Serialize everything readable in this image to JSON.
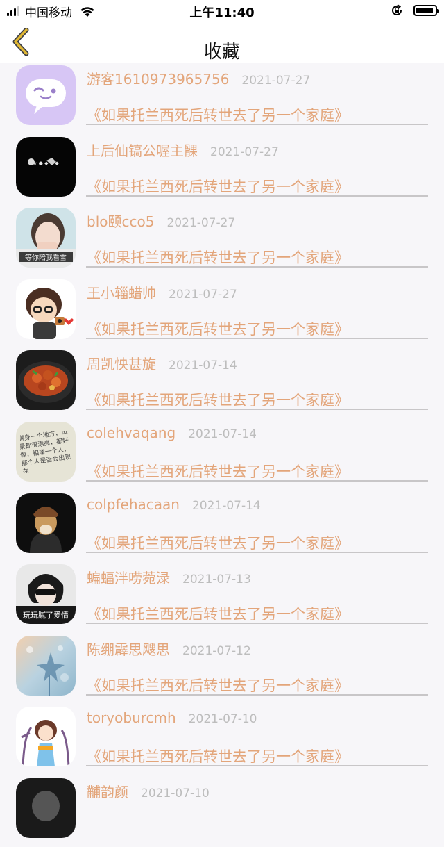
{
  "status_bar": {
    "carrier": "中国移动",
    "time": "上午11:40"
  },
  "nav": {
    "title": "收藏",
    "back_icon": "chevron-left-icon",
    "accent": "#e0b733"
  },
  "favorites": [
    {
      "user": "游客1610973965756",
      "date": "2021-07-27",
      "title": "《如果托兰西死后转世去了另一个家庭》"
    },
    {
      "user": "上后仙镐公喔主髁",
      "date": "2021-07-27",
      "title": "《如果托兰西死后转世去了另一个家庭》"
    },
    {
      "user": "blo颐cco5",
      "date": "2021-07-27",
      "title": "《如果托兰西死后转世去了另一个家庭》"
    },
    {
      "user": "王小辎蜡帅",
      "date": "2021-07-27",
      "title": "《如果托兰西死后转世去了另一个家庭》"
    },
    {
      "user": "周凯怏甚旋",
      "date": "2021-07-14",
      "title": "《如果托兰西死后转世去了另一个家庭》"
    },
    {
      "user": "colehvaqang",
      "date": "2021-07-14",
      "title": "《如果托兰西死后转世去了另一个家庭》"
    },
    {
      "user": "colpfehacaan",
      "date": "2021-07-14",
      "title": "《如果托兰西死后转世去了另一个家庭》"
    },
    {
      "user": "蝙蝠泮唠菀渌",
      "date": "2021-07-13",
      "title": "《如果托兰西死后转世去了另一个家庭》"
    },
    {
      "user": "陈绷霹思飕思",
      "date": "2021-07-12",
      "title": "《如果托兰西死后转世去了另一个家庭》"
    },
    {
      "user": "toryoburcmh",
      "date": "2021-07-10",
      "title": "《如果托兰西死后转世去了另一个家庭》"
    },
    {
      "user": "黼韵颜",
      "date": "2021-07-10",
      "title": ""
    }
  ],
  "avatar_texts": {
    "a1": "★ ● ◆ ◆ ◆",
    "a2": "等你陪我看雪",
    "a5": "满身一个地方，风景都很漂亮，都好像，相逢一个人，那个人是否会出现在",
    "a7": "玩玩腻了爱情"
  },
  "colors": {
    "accent_text": "#e3a57a",
    "date_text": "#bdbdbd",
    "divider": "#c8c6c8",
    "background": "#f7f6f9"
  }
}
